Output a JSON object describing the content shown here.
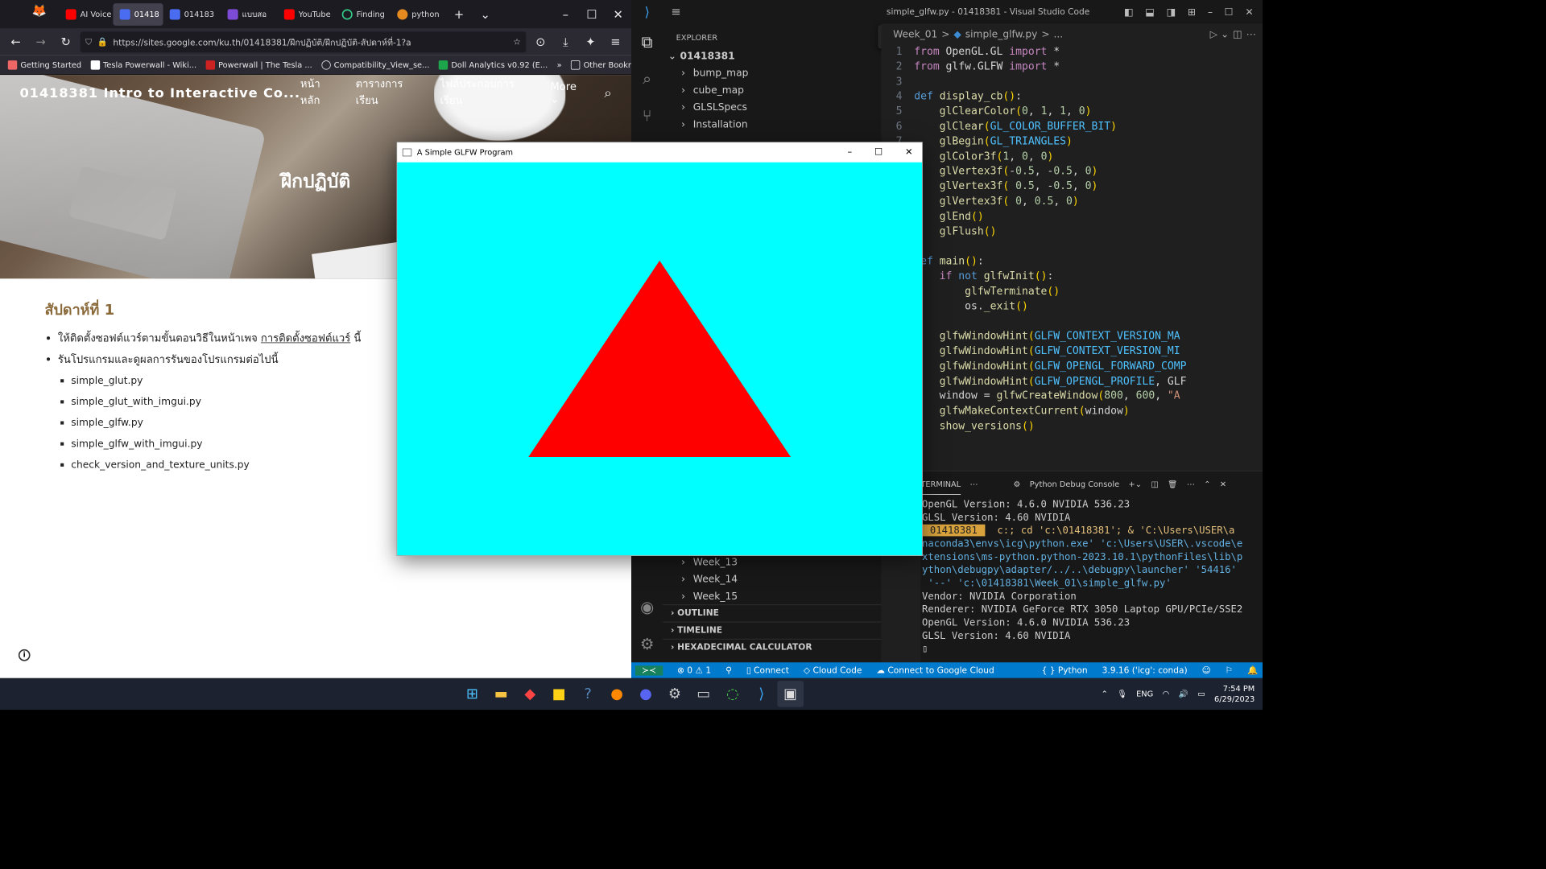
{
  "firefox": {
    "tabs": [
      "AI Voice",
      "01418",
      "014183",
      "แบบสอ",
      "YouTube",
      "Finding",
      "python"
    ],
    "url": "https://sites.google.com/ku.th/01418381/ฝึกปฏิบัติ/ฝึกปฏิบัติ-สัปดาห์ที่-1?a",
    "bookmarks": [
      "Getting Started",
      "Tesla Powerwall - Wiki...",
      "Powerwall | The Tesla ...",
      "Compatibility_View_se...",
      "Doll Analytics v0.92 (E...",
      "Other Bookmarks"
    ]
  },
  "site": {
    "title": "01418381 Intro to Interactive Co...",
    "nav": [
      "หน้าหลัก",
      "ตารางการเรียน",
      "ไฟล์ประกอบการเรียน",
      "More"
    ],
    "hero": "ฝึกปฏิบัติ",
    "week": "สัปดาห์ที่ 1",
    "bullet1_a": "ให้ติดตั้งซอฟต์แวร์ตามขั้นตอนวิธีในหน้าเพจ ",
    "bullet1_link": "การติดตั้งซอฟต์แวร์",
    "bullet1_b": " นี้",
    "bullet2": "รันโปรแกรมและดูผลการรันของโปรแกรมต่อไปนี้",
    "files": [
      "simple_glut.py",
      "simple_glut_with_imgui.py",
      "simple_glfw.py",
      "simple_glfw_with_imgui.py",
      "check_version_and_texture_units.py"
    ]
  },
  "glfw": {
    "title": "A Simple GLFW Program",
    "clear_color": "#00ffff",
    "tri_color": "#ff0000"
  },
  "vscode": {
    "title": "simple_glfw.py - 01418381 - Visual Studio Code",
    "explorer": "EXPLORER",
    "root": "01418381",
    "folders": [
      "bump_map",
      "cube_map",
      "GLSLSpecs",
      "Installation"
    ],
    "folders_low": [
      "Week_13",
      "Week_14",
      "Week_15"
    ],
    "sections": [
      "OUTLINE",
      "TIMELINE",
      "HEXADECIMAL CALCULATOR"
    ],
    "breadcrumb": [
      "Week_01",
      ">",
      "simple_glfw.py",
      ">",
      "..."
    ],
    "term_tab": "TERMINAL",
    "debug_console": "Python Debug Console",
    "term": [
      "OpenGL Version: 4.6.0 NVIDIA 536.23",
      "GLSL Version: 4.60 NVIDIA",
      "Vendor: NVIDIA Corporation",
      "Renderer: NVIDIA GeForce RTX 3050 Laptop GPU/PCIe/SSE2",
      "OpenGL Version: 4.6.0 NVIDIA 536.23",
      "GLSL Version: 4.60 NVIDIA"
    ],
    "prompt": "01418381",
    "cmd": [
      "c:; cd 'c:\\01418381'; & 'C:\\Users\\USER\\a",
      "naconda3\\envs\\icg\\python.exe' 'c:\\Users\\USER\\.vscode\\e",
      "xtensions\\ms-python.python-2023.10.1\\pythonFiles\\lib\\p",
      "ython\\debugpy\\adapter/../..\\debugpy\\launcher' '54416'",
      " '--' 'c:\\01418381\\Week_01\\simple_glfw.py'"
    ],
    "status": [
      "⊗ 0 ⚠ 1",
      "Connect",
      "Cloud Code",
      "Connect to Google Cloud",
      "Python",
      "3.9.16 ('icg': conda)"
    ]
  },
  "taskbar": {
    "lang": "ENG",
    "time": "7:54 PM",
    "date": "6/29/2023"
  }
}
